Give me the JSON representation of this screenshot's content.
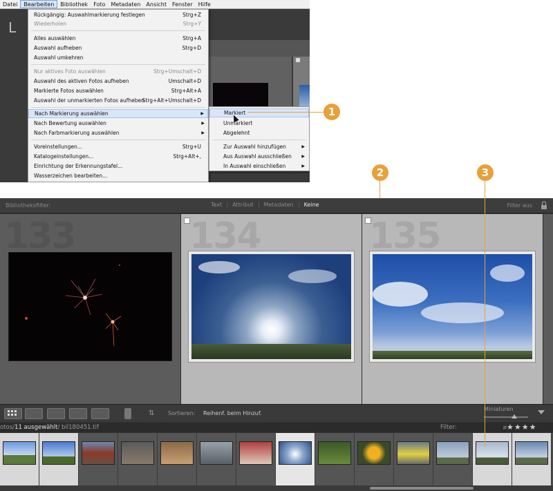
{
  "menubar": {
    "items": [
      "Datei",
      "Bearbeiten",
      "Bibliothek",
      "Foto",
      "Metadaten",
      "Ansicht",
      "Fenster",
      "Hilfe"
    ],
    "active": "Bearbeiten"
  },
  "menu": {
    "items": [
      {
        "label": "Rückgängig: Auswahlmarkierung festlegen",
        "shortcut": "Strg+Z",
        "disabled": false
      },
      {
        "label": "Wiederholen",
        "shortcut": "Strg+Y",
        "disabled": true
      },
      {
        "label": "Alles auswählen",
        "shortcut": "Strg+A",
        "disabled": false
      },
      {
        "label": "Auswahl aufheben",
        "shortcut": "Strg+D",
        "disabled": false
      },
      {
        "label": "Auswahl umkehren",
        "shortcut": "",
        "disabled": false
      },
      {
        "label": "Nur aktives Foto auswählen",
        "shortcut": "Strg+Umschalt+D",
        "disabled": true
      },
      {
        "label": "Auswahl des aktiven Fotos aufheben",
        "shortcut": "Umschalt+D",
        "disabled": false
      },
      {
        "label": "Markierte Fotos auswählen",
        "shortcut": "Strg+Alt+A",
        "disabled": false
      },
      {
        "label": "Auswahl der unmarkierten Fotos aufheben",
        "shortcut": "Strg+Alt+Umschalt+D",
        "disabled": false
      },
      {
        "label": "Nach Markierung auswählen",
        "shortcut": "",
        "disabled": false,
        "submenu": true
      },
      {
        "label": "Nach Bewertung auswählen",
        "shortcut": "",
        "disabled": false,
        "submenu": true
      },
      {
        "label": "Nach Farbmarkierung auswählen",
        "shortcut": "",
        "disabled": false,
        "submenu": true
      },
      {
        "label": "Voreinstellungen...",
        "shortcut": "Strg+U",
        "disabled": false
      },
      {
        "label": "Katalogeinstellungen...",
        "shortcut": "Strg+Alt+,",
        "disabled": false
      },
      {
        "label": "Einrichtung der Erkennungstafel...",
        "shortcut": "",
        "disabled": false
      },
      {
        "label": "Wasserzeichen bearbeiten...",
        "shortcut": "",
        "disabled": false
      }
    ]
  },
  "submenu": {
    "items": [
      "Markiert",
      "Unmarkiert",
      "Abgelehnt",
      "Zur Auswahl hinzufügen",
      "Aus Auswahl ausschließen",
      "In Auswahl einschließen"
    ]
  },
  "callouts": [
    "1",
    "2",
    "3"
  ],
  "inset": {
    "app_letter": "L"
  },
  "filterbar": {
    "label": "Bibliotheksfilter:",
    "tabs": [
      "Text",
      "Attribut",
      "Metadaten",
      "Keine"
    ],
    "active_tab": "Keine",
    "status": "Filter aus"
  },
  "grid": {
    "cells": [
      {
        "number": "133",
        "selected": false
      },
      {
        "number": "134",
        "selected": true
      },
      {
        "number": "135",
        "selected": true
      }
    ]
  },
  "toolbar": {
    "sort_label": "Sortieren:",
    "sort_value": "Reihenf. beim Hinzuf.",
    "thumbnail_label": "Miniaturen"
  },
  "statusbar": {
    "path_prefix": "otos/",
    "selected": "11 ausgewählt",
    "path_suffix": "/ bil180451.tif",
    "filter_label": "Filter:",
    "star_operator": "≥",
    "stars": "★★★★"
  },
  "colors": {
    "accent": "#e9a03a",
    "menu_highlight": "#d8e6f8",
    "dark_panel": "#333333",
    "selected_cell": "#b8b8b8"
  }
}
